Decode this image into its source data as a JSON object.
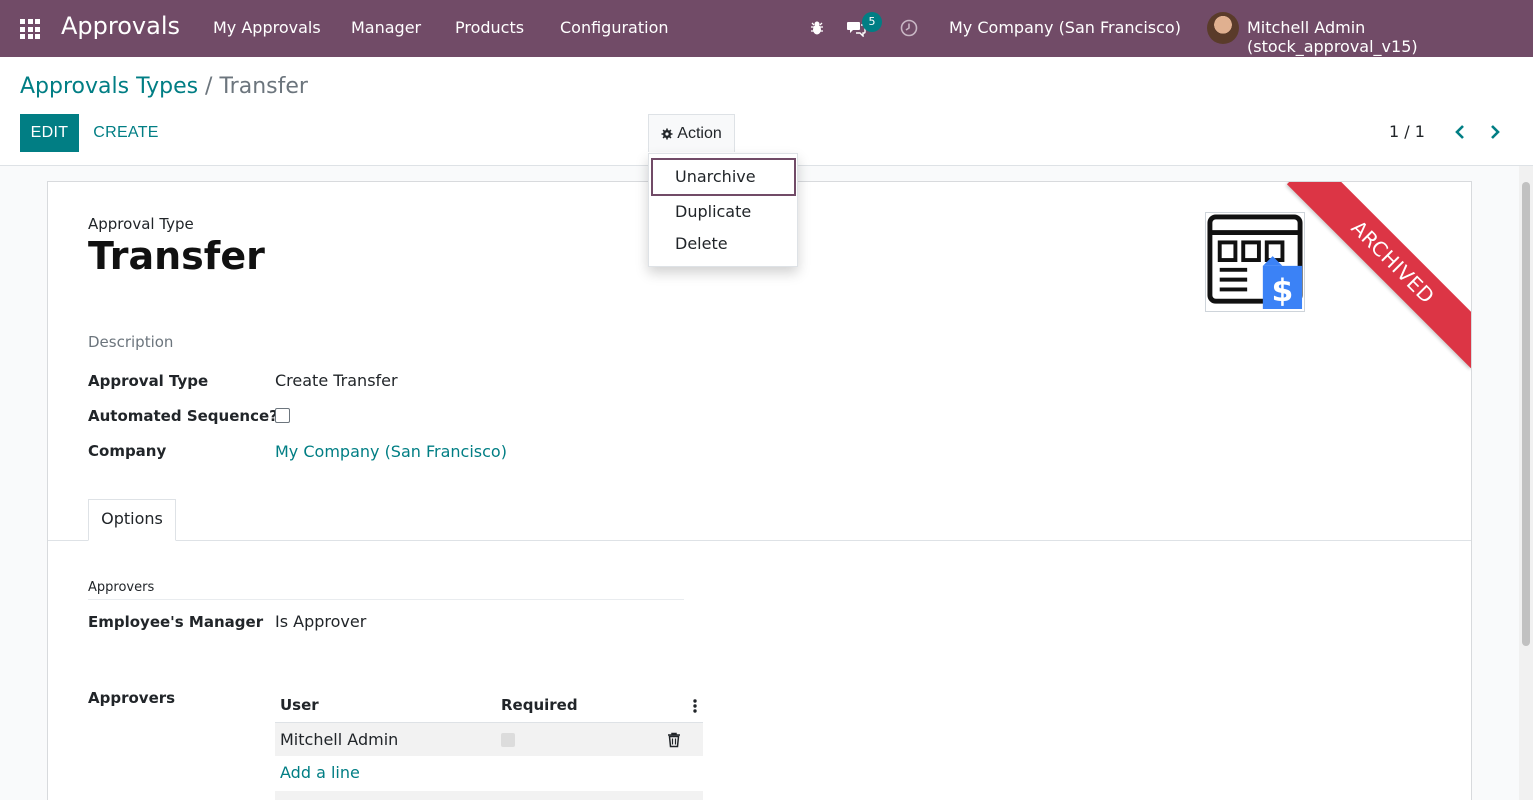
{
  "navbar": {
    "brand": "Approvals",
    "menu": [
      "My Approvals",
      "Manager",
      "Products",
      "Configuration"
    ],
    "chat_badge": "5",
    "company": "My Company (San Francisco)",
    "user": "Mitchell Admin (stock_approval_v15)"
  },
  "control_panel": {
    "breadcrumb_parent": "Approvals Types",
    "breadcrumb_sep": " / ",
    "breadcrumb_current": "Transfer",
    "edit_label": "EDIT",
    "create_label": "CREATE",
    "action_label": "Action",
    "pager": "1 / 1"
  },
  "action_menu": {
    "items": [
      "Unarchive",
      "Duplicate",
      "Delete"
    ]
  },
  "form": {
    "ribbon": "ARCHIVED",
    "type_label": "Approval Type",
    "title": "Transfer",
    "description_label": "Description",
    "fields": {
      "approval_type_label": "Approval Type",
      "approval_type_value": "Create Transfer",
      "automated_sequence_label": "Automated Sequence?",
      "company_label": "Company",
      "company_value": "My Company (San Francisco)"
    },
    "tab": "Options",
    "approvers_separator": "Approvers",
    "employee_manager_label": "Employee's Manager",
    "employee_manager_value": "Is Approver",
    "approvers_label": "Approvers",
    "table": {
      "columns": [
        "User",
        "Required"
      ],
      "rows": [
        {
          "user": "Mitchell Admin",
          "required": false
        }
      ],
      "add_line": "Add a line"
    }
  },
  "colors": {
    "navbar": "#714b67",
    "primary": "#017e84",
    "ribbon": "#dc3545"
  }
}
